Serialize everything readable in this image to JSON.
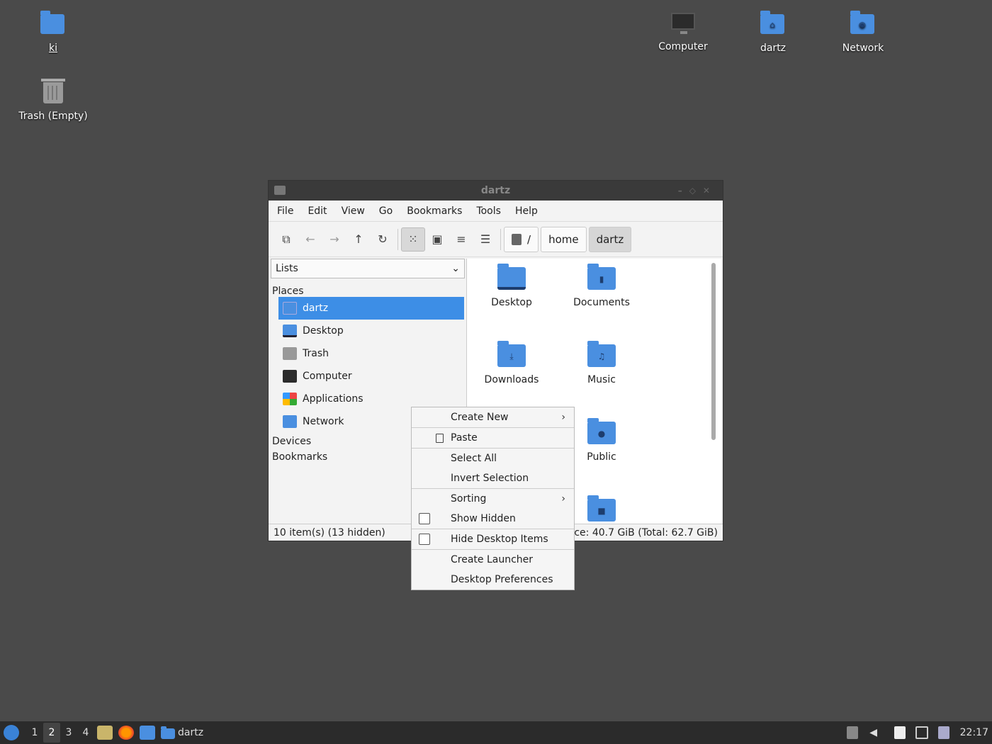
{
  "desktop": {
    "icons": {
      "ki": "ki",
      "trash": "Trash (Empty)",
      "computer": "Computer",
      "home": "dartz",
      "network": "Network"
    }
  },
  "window": {
    "title": "dartz",
    "menu": [
      "File",
      "Edit",
      "View",
      "Go",
      "Bookmarks",
      "Tools",
      "Help"
    ],
    "breadcrumb": [
      "/",
      "home",
      "dartz"
    ],
    "side": {
      "selector": "Lists",
      "places_label": "Places",
      "places": [
        "dartz",
        "Desktop",
        "Trash",
        "Computer",
        "Applications",
        "Network"
      ],
      "devices_label": "Devices",
      "bookmarks_label": "Bookmarks"
    },
    "files": [
      "Desktop",
      "Documents",
      "Downloads",
      "Music",
      "Public"
    ],
    "status_left": "10 item(s) (13 hidden)",
    "status_right": "ce: 40.7 GiB (Total: 62.7 GiB)"
  },
  "context_menu": {
    "create_new": "Create New",
    "paste": "Paste",
    "select_all": "Select All",
    "invert_selection": "Invert Selection",
    "sorting": "Sorting",
    "show_hidden": "Show Hidden",
    "hide_desktop_items": "Hide Desktop Items",
    "create_launcher": "Create Launcher",
    "desktop_preferences": "Desktop Preferences"
  },
  "taskbar": {
    "workspaces": [
      "1",
      "2",
      "3",
      "4"
    ],
    "task_label": "dartz",
    "clock": "22:17"
  }
}
